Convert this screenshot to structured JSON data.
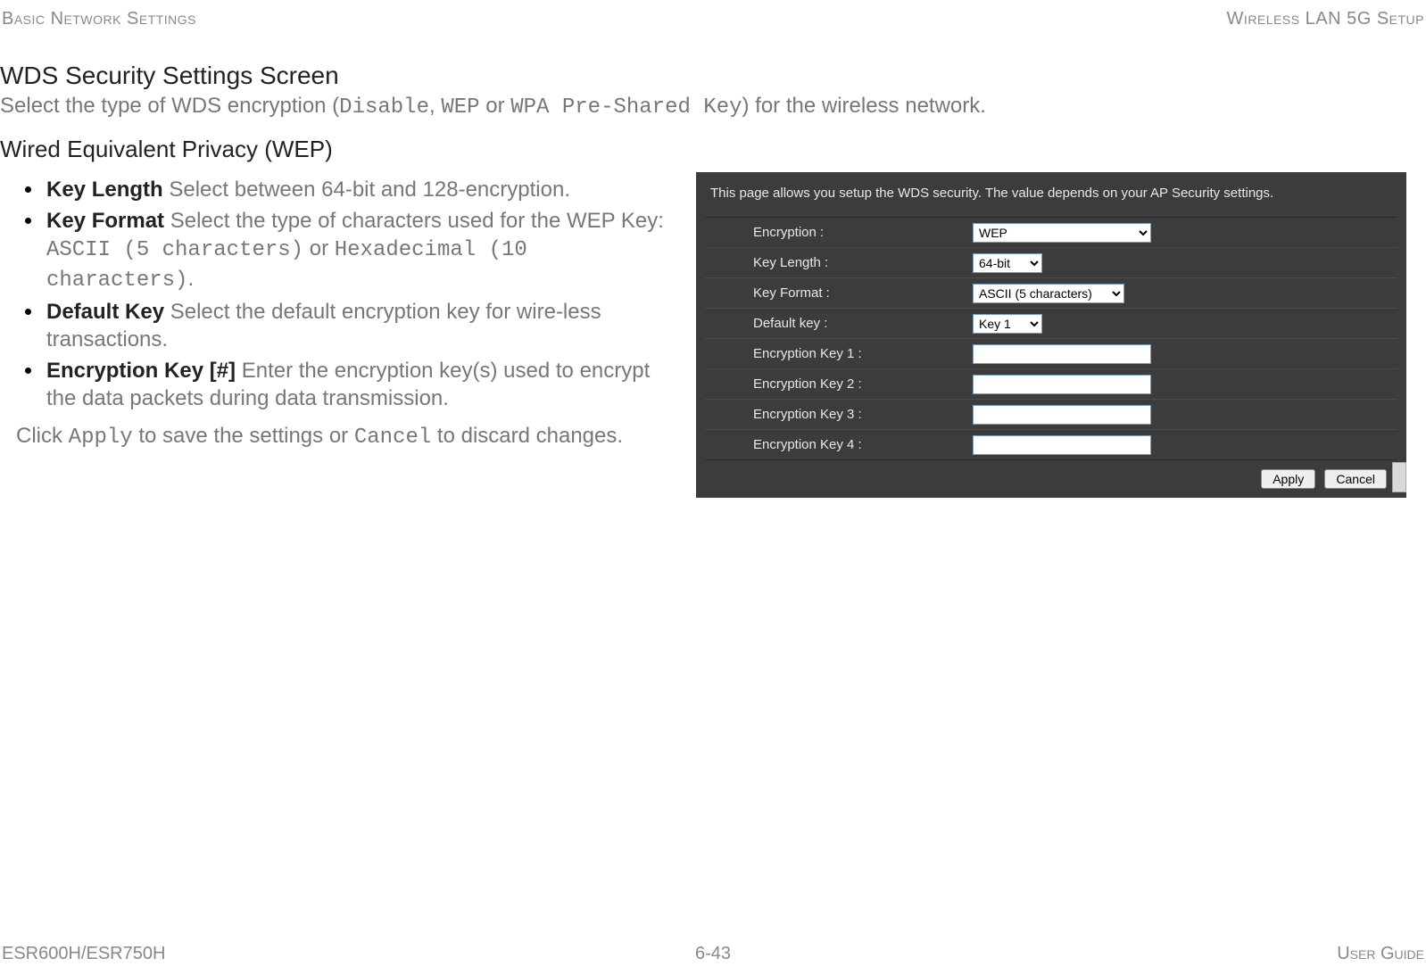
{
  "header": {
    "left": "Basic Network Settings",
    "right": "Wireless LAN 5G Setup"
  },
  "title": "WDS Security Settings Screen",
  "intro": {
    "pre": "Select the type of WDS encryption (",
    "opt1": "Disable",
    "sep1": ", ",
    "opt2": "WEP",
    "mid": " or ",
    "opt3": "WPA Pre-Shared Key",
    "post": ") for the wireless network."
  },
  "subtitle": "Wired Equivalent Privacy (WEP)",
  "bullets": {
    "kl_term": "Key Length",
    "kl_desc": "  Select between 64-bit and 128-encryption.",
    "kf_term": "Key Format",
    "kf_desc_pre": "  Select the type of characters used for the WEP Key: ",
    "kf_mono1": "ASCII (5 characters)",
    "kf_or": " or ",
    "kf_mono2": "Hexadecimal (10 characters)",
    "kf_desc_post": ".",
    "dk_term": "Default Key",
    "dk_desc": "  Select the default encryption key for wire-less transactions.",
    "ek_term": "Encryption Key [#]",
    "ek_desc": "  Enter the encryption key(s) used to encrypt the data packets during data transmission."
  },
  "note": {
    "pre": "Click ",
    "apply": "Apply",
    "mid": " to save the settings or ",
    "cancel": "Cancel",
    "post": " to discard changes."
  },
  "panel": {
    "desc": "This page allows you setup the WDS security. The value depends on your AP Security settings.",
    "rows": {
      "encryption_label": "Encryption :",
      "encryption_value": "WEP",
      "keylength_label": "Key Length :",
      "keylength_value": "64-bit",
      "keyformat_label": "Key Format :",
      "keyformat_value": "ASCII (5 characters)",
      "defaultkey_label": "Default key :",
      "defaultkey_value": "Key 1",
      "ek1_label": "Encryption Key 1 :",
      "ek1_value": "",
      "ek2_label": "Encryption Key 2 :",
      "ek2_value": "",
      "ek3_label": "Encryption Key 3 :",
      "ek3_value": "",
      "ek4_label": "Encryption Key 4 :",
      "ek4_value": ""
    },
    "apply_label": "Apply",
    "cancel_label": "Cancel"
  },
  "footer": {
    "left": "ESR600H/ESR750H",
    "center": "6-43",
    "right": "User Guide"
  }
}
